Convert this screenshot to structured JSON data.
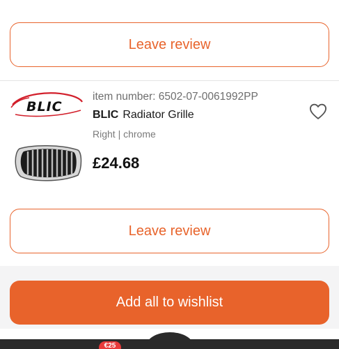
{
  "review_section_top": {
    "button_label": "Leave review"
  },
  "product": {
    "item_number": "item number: 6502-07-0061992PP",
    "brand": "BLIC",
    "name": "Radiator Grille",
    "specs": "Right | chrome",
    "price": "£24.68",
    "logo_text": "BLIC",
    "wishlist_icon": "heart-outline-icon"
  },
  "review_section_bottom": {
    "button_label": "Leave review"
  },
  "actions": {
    "add_all_label": "Add all to wishlist"
  },
  "bottom_nav": {
    "badge": "€25"
  },
  "colors": {
    "accent": "#e8642c",
    "badge": "#e83a3a",
    "nav": "#2a2a2a"
  }
}
